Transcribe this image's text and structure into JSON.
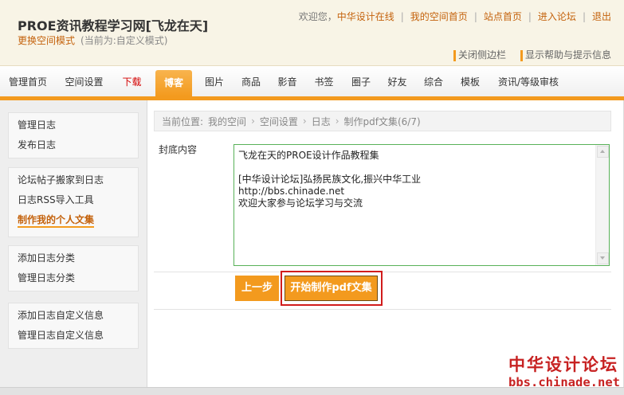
{
  "header": {
    "site_title": "PROE资讯教程学习网[飞龙在天]",
    "change_mode": "更换空间模式",
    "current_mode": "(当前为:自定义模式)",
    "welcome": "欢迎您，",
    "username": "中华设计在线",
    "separator": "|",
    "links": [
      "我的空间首页",
      "站点首页",
      "进入论坛",
      "退出"
    ],
    "close_sidebar": "关闭侧边栏",
    "show_help": "显示帮助与提示信息"
  },
  "nav": {
    "tabs": [
      {
        "label": "管理首页"
      },
      {
        "label": "空间设置"
      },
      {
        "label": "下载"
      },
      {
        "label": "博客",
        "active": true
      },
      {
        "label": "图片"
      },
      {
        "label": "商品"
      },
      {
        "label": "影音"
      },
      {
        "label": "书签"
      },
      {
        "label": "圈子"
      },
      {
        "label": "好友"
      },
      {
        "label": "综合"
      },
      {
        "label": "模板"
      },
      {
        "label": "资讯/等级审核"
      }
    ]
  },
  "sidebar": {
    "groups": [
      {
        "items": [
          {
            "label": "管理日志"
          },
          {
            "label": "发布日志"
          }
        ]
      },
      {
        "items": [
          {
            "label": "论坛帖子搬家到日志"
          },
          {
            "label": "日志RSS导入工具"
          },
          {
            "label": "制作我的个人文集",
            "current": true
          }
        ]
      },
      {
        "items": [
          {
            "label": "添加日志分类"
          },
          {
            "label": "管理日志分类"
          }
        ]
      },
      {
        "items": [
          {
            "label": "添加日志自定义信息"
          },
          {
            "label": "管理日志自定义信息"
          }
        ]
      }
    ]
  },
  "breadcrumb": {
    "prefix": "当前位置:",
    "separator": "›",
    "items": [
      "我的空间",
      "空间设置",
      "日志",
      "制作pdf文集(6/7)"
    ]
  },
  "form": {
    "back_cover_label": "封底内容",
    "back_cover_value": "飞龙在天的PROE设计作品教程集\n\n[中华设计论坛]弘扬民族文化,振兴中华工业\nhttp://bbs.chinade.net\n欢迎大家参与论坛学习与交流",
    "prev_button": "上一步",
    "submit_button": "开始制作pdf文集"
  },
  "watermark": {
    "line1": "中华设计论坛",
    "line2": "bbs.chinade.net"
  },
  "colors": {
    "accent": "#f39a1e",
    "link": "#c4620c",
    "download_tab": "#d40000",
    "textarea_border": "#58b158",
    "annotation": "#d11c1c",
    "watermark": "#c72222",
    "header_bg": "#f8f4e6"
  }
}
